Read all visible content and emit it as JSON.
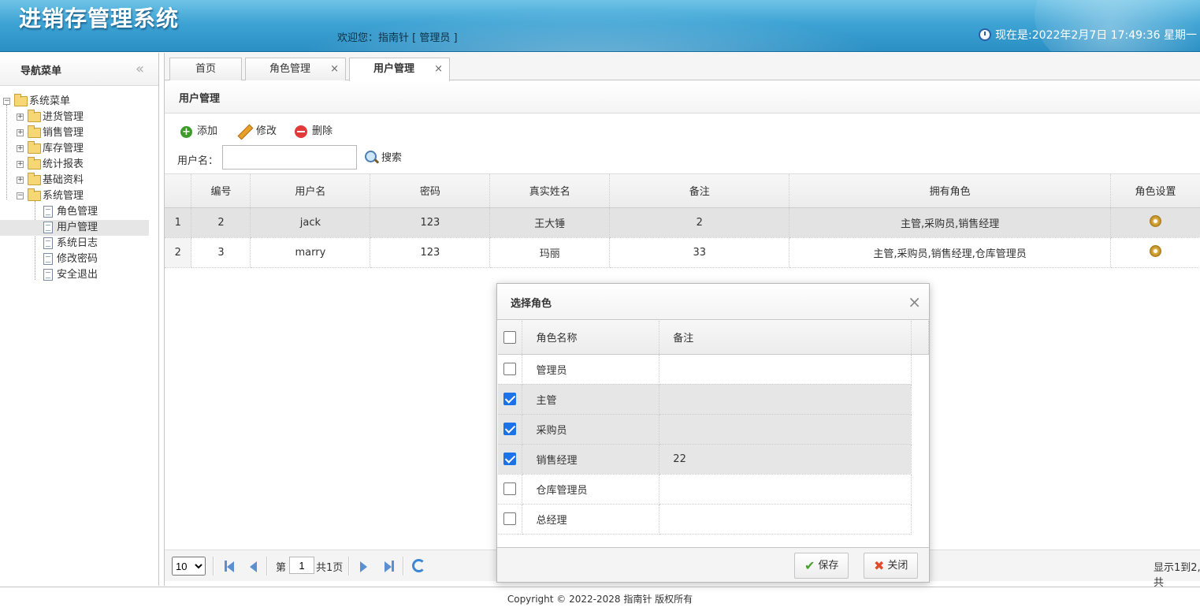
{
  "header": {
    "title": "进销存管理系统",
    "welcome": "欢迎您：指南针 [ 管理员 ]",
    "clock": "现在是:2022年2月7日 17:49:36 星期一"
  },
  "sidebar": {
    "title": "导航菜单",
    "collapse": "«",
    "root": "系统菜单",
    "groups": [
      "进货管理",
      "销售管理",
      "库存管理",
      "统计报表",
      "基础资料",
      "系统管理"
    ],
    "items": [
      "角色管理",
      "用户管理",
      "系统日志",
      "修改密码",
      "安全退出"
    ]
  },
  "tabs": [
    {
      "label": "首页"
    },
    {
      "label": "角色管理",
      "close": "×"
    },
    {
      "label": "用户管理",
      "close": "×"
    }
  ],
  "panel": {
    "title": "用户管理",
    "toolbar": {
      "add": "添加",
      "edit": "修改",
      "delete": "删除",
      "search_label": "用户名：",
      "search_value": "",
      "search": "搜索"
    }
  },
  "grid": {
    "columns": [
      "编号",
      "用户名",
      "密码",
      "真实姓名",
      "备注",
      "拥有角色",
      "角色设置"
    ],
    "rows": [
      {
        "rn": "1",
        "id": "2",
        "username": "jack",
        "password": "123",
        "realname": "王大锤",
        "remark": "2",
        "roles": "主管,采购员,销售经理"
      },
      {
        "rn": "2",
        "id": "3",
        "username": "marry",
        "password": "123",
        "realname": "玛丽",
        "remark": "33",
        "roles": "主管,采购员,销售经理,仓库管理员"
      }
    ]
  },
  "pager": {
    "page_size": "10",
    "page_prefix": "第",
    "page": "1",
    "page_total": "共1页",
    "display": "显示1到2,共"
  },
  "dialog": {
    "title": "选择角色",
    "close": "×",
    "columns": [
      "角色名称",
      "备注"
    ],
    "rows": [
      {
        "name": "管理员",
        "remark": "",
        "checked": false
      },
      {
        "name": "主管",
        "remark": "",
        "checked": true
      },
      {
        "name": "采购员",
        "remark": "",
        "checked": true
      },
      {
        "name": "销售经理",
        "remark": "22",
        "checked": true
      },
      {
        "name": "仓库管理员",
        "remark": "",
        "checked": false
      },
      {
        "name": "总经理",
        "remark": "",
        "checked": false
      }
    ],
    "save": "保存",
    "cancel": "关闭"
  },
  "footer": "Copyright © 2022-2028 指南针 版权所有"
}
